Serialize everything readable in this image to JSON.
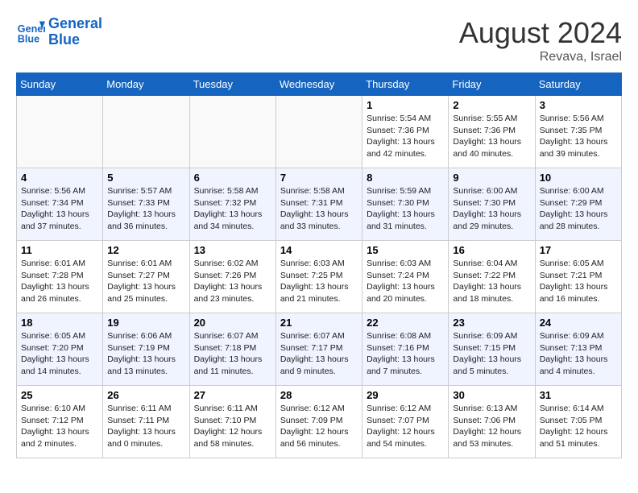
{
  "header": {
    "logo_line1": "General",
    "logo_line2": "Blue",
    "month_year": "August 2024",
    "location": "Revava, Israel"
  },
  "days_of_week": [
    "Sunday",
    "Monday",
    "Tuesday",
    "Wednesday",
    "Thursday",
    "Friday",
    "Saturday"
  ],
  "weeks": [
    [
      {
        "day": "",
        "info": ""
      },
      {
        "day": "",
        "info": ""
      },
      {
        "day": "",
        "info": ""
      },
      {
        "day": "",
        "info": ""
      },
      {
        "day": "1",
        "info": "Sunrise: 5:54 AM\nSunset: 7:36 PM\nDaylight: 13 hours\nand 42 minutes."
      },
      {
        "day": "2",
        "info": "Sunrise: 5:55 AM\nSunset: 7:36 PM\nDaylight: 13 hours\nand 40 minutes."
      },
      {
        "day": "3",
        "info": "Sunrise: 5:56 AM\nSunset: 7:35 PM\nDaylight: 13 hours\nand 39 minutes."
      }
    ],
    [
      {
        "day": "4",
        "info": "Sunrise: 5:56 AM\nSunset: 7:34 PM\nDaylight: 13 hours\nand 37 minutes."
      },
      {
        "day": "5",
        "info": "Sunrise: 5:57 AM\nSunset: 7:33 PM\nDaylight: 13 hours\nand 36 minutes."
      },
      {
        "day": "6",
        "info": "Sunrise: 5:58 AM\nSunset: 7:32 PM\nDaylight: 13 hours\nand 34 minutes."
      },
      {
        "day": "7",
        "info": "Sunrise: 5:58 AM\nSunset: 7:31 PM\nDaylight: 13 hours\nand 33 minutes."
      },
      {
        "day": "8",
        "info": "Sunrise: 5:59 AM\nSunset: 7:30 PM\nDaylight: 13 hours\nand 31 minutes."
      },
      {
        "day": "9",
        "info": "Sunrise: 6:00 AM\nSunset: 7:30 PM\nDaylight: 13 hours\nand 29 minutes."
      },
      {
        "day": "10",
        "info": "Sunrise: 6:00 AM\nSunset: 7:29 PM\nDaylight: 13 hours\nand 28 minutes."
      }
    ],
    [
      {
        "day": "11",
        "info": "Sunrise: 6:01 AM\nSunset: 7:28 PM\nDaylight: 13 hours\nand 26 minutes."
      },
      {
        "day": "12",
        "info": "Sunrise: 6:01 AM\nSunset: 7:27 PM\nDaylight: 13 hours\nand 25 minutes."
      },
      {
        "day": "13",
        "info": "Sunrise: 6:02 AM\nSunset: 7:26 PM\nDaylight: 13 hours\nand 23 minutes."
      },
      {
        "day": "14",
        "info": "Sunrise: 6:03 AM\nSunset: 7:25 PM\nDaylight: 13 hours\nand 21 minutes."
      },
      {
        "day": "15",
        "info": "Sunrise: 6:03 AM\nSunset: 7:24 PM\nDaylight: 13 hours\nand 20 minutes."
      },
      {
        "day": "16",
        "info": "Sunrise: 6:04 AM\nSunset: 7:22 PM\nDaylight: 13 hours\nand 18 minutes."
      },
      {
        "day": "17",
        "info": "Sunrise: 6:05 AM\nSunset: 7:21 PM\nDaylight: 13 hours\nand 16 minutes."
      }
    ],
    [
      {
        "day": "18",
        "info": "Sunrise: 6:05 AM\nSunset: 7:20 PM\nDaylight: 13 hours\nand 14 minutes."
      },
      {
        "day": "19",
        "info": "Sunrise: 6:06 AM\nSunset: 7:19 PM\nDaylight: 13 hours\nand 13 minutes."
      },
      {
        "day": "20",
        "info": "Sunrise: 6:07 AM\nSunset: 7:18 PM\nDaylight: 13 hours\nand 11 minutes."
      },
      {
        "day": "21",
        "info": "Sunrise: 6:07 AM\nSunset: 7:17 PM\nDaylight: 13 hours\nand 9 minutes."
      },
      {
        "day": "22",
        "info": "Sunrise: 6:08 AM\nSunset: 7:16 PM\nDaylight: 13 hours\nand 7 minutes."
      },
      {
        "day": "23",
        "info": "Sunrise: 6:09 AM\nSunset: 7:15 PM\nDaylight: 13 hours\nand 5 minutes."
      },
      {
        "day": "24",
        "info": "Sunrise: 6:09 AM\nSunset: 7:13 PM\nDaylight: 13 hours\nand 4 minutes."
      }
    ],
    [
      {
        "day": "25",
        "info": "Sunrise: 6:10 AM\nSunset: 7:12 PM\nDaylight: 13 hours\nand 2 minutes."
      },
      {
        "day": "26",
        "info": "Sunrise: 6:11 AM\nSunset: 7:11 PM\nDaylight: 13 hours\nand 0 minutes."
      },
      {
        "day": "27",
        "info": "Sunrise: 6:11 AM\nSunset: 7:10 PM\nDaylight: 12 hours\nand 58 minutes."
      },
      {
        "day": "28",
        "info": "Sunrise: 6:12 AM\nSunset: 7:09 PM\nDaylight: 12 hours\nand 56 minutes."
      },
      {
        "day": "29",
        "info": "Sunrise: 6:12 AM\nSunset: 7:07 PM\nDaylight: 12 hours\nand 54 minutes."
      },
      {
        "day": "30",
        "info": "Sunrise: 6:13 AM\nSunset: 7:06 PM\nDaylight: 12 hours\nand 53 minutes."
      },
      {
        "day": "31",
        "info": "Sunrise: 6:14 AM\nSunset: 7:05 PM\nDaylight: 12 hours\nand 51 minutes."
      }
    ]
  ]
}
